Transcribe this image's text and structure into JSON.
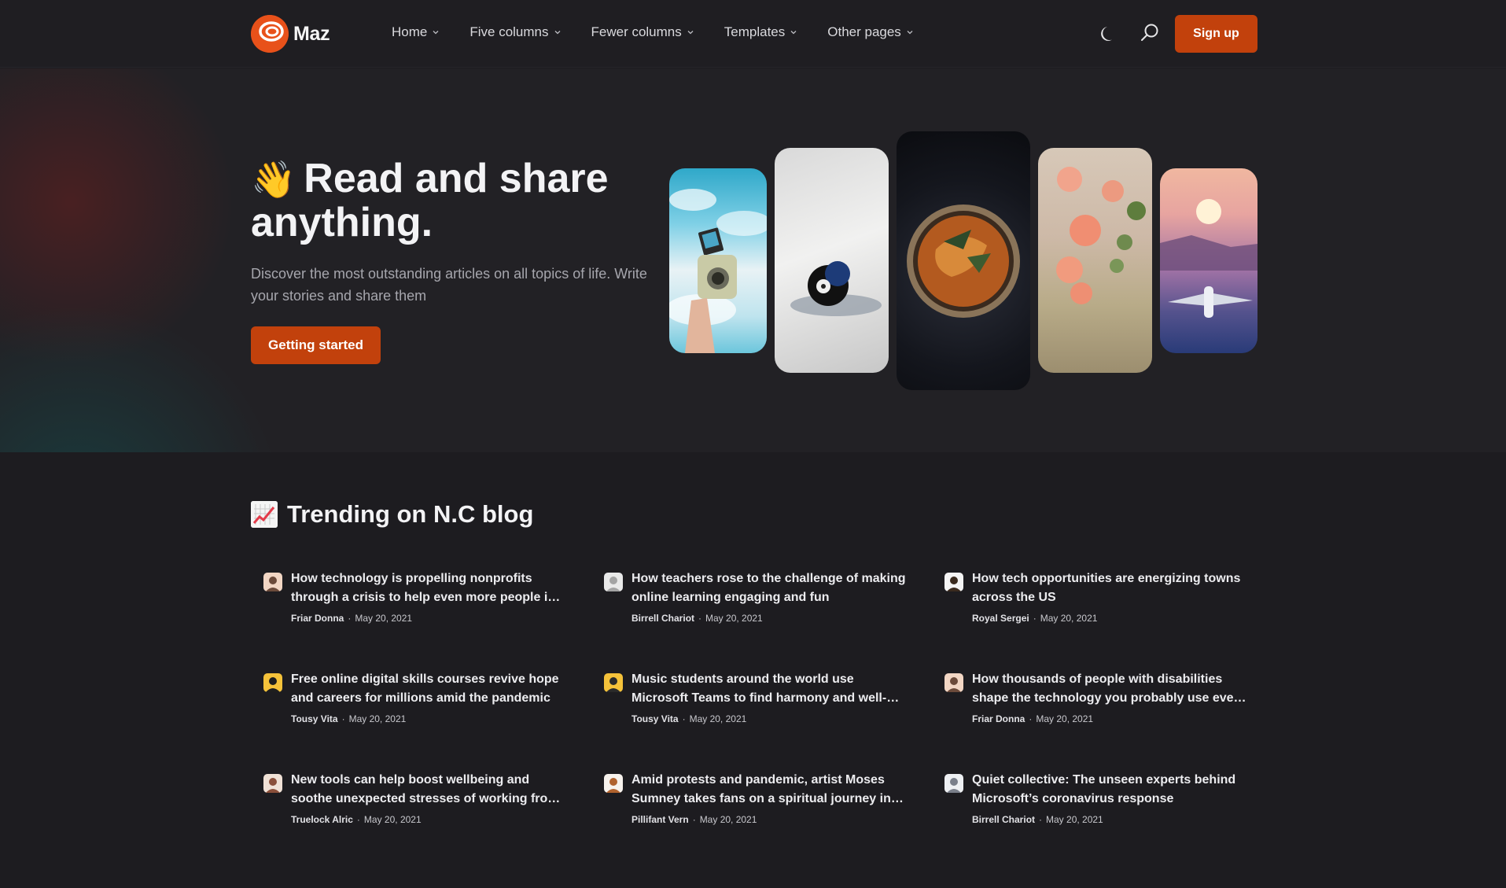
{
  "brand": {
    "name": "Maz"
  },
  "nav": {
    "items": [
      {
        "label": "Home"
      },
      {
        "label": "Five columns"
      },
      {
        "label": "Fewer columns"
      },
      {
        "label": "Templates"
      },
      {
        "label": "Other pages"
      }
    ],
    "signup_label": "Sign up"
  },
  "hero": {
    "emoji": "👋",
    "title": "Read and share anything.",
    "subtitle": "Discover the most outstanding articles on all topics of life. Write your stories and share them",
    "cta_label": "Getting started"
  },
  "trending": {
    "emoji": "📈",
    "title": "Trending on N.C blog",
    "posts": [
      {
        "title": "How technology is propelling nonprofits through a crisis to help even more people in need",
        "author": "Friar Donna",
        "date": "May 20, 2021"
      },
      {
        "title": "How teachers rose to the challenge of making online learning engaging and fun",
        "author": "Birrell Chariot",
        "date": "May 20, 2021"
      },
      {
        "title": "How tech opportunities are energizing towns across the US",
        "author": "Royal Sergei",
        "date": "May 20, 2021"
      },
      {
        "title": "Free online digital skills courses revive hope and careers for millions amid the pandemic",
        "author": "Tousy Vita",
        "date": "May 20, 2021"
      },
      {
        "title": "Music students around the world use Microsoft Teams to find harmony and well-being",
        "author": "Tousy Vita",
        "date": "May 20, 2021"
      },
      {
        "title": "How thousands of people with disabilities shape the technology you probably use every day",
        "author": "Friar Donna",
        "date": "May 20, 2021"
      },
      {
        "title": "New tools can help boost wellbeing and soothe unexpected stresses of working from home",
        "author": "Truelock Alric",
        "date": "May 20, 2021"
      },
      {
        "title": "Amid protests and pandemic, artist Moses Sumney takes fans on a spiritual journey in his music",
        "author": "Pillifant Vern",
        "date": "May 20, 2021"
      },
      {
        "title": "Quiet collective: The unseen experts behind Microsoft’s coronavirus response",
        "author": "Birrell Chariot",
        "date": "May 20, 2021"
      }
    ],
    "meta_separator": "·"
  },
  "colors": {
    "accent": "#c2410c",
    "background": "#1d1c20",
    "hero_bg": "#222125"
  }
}
